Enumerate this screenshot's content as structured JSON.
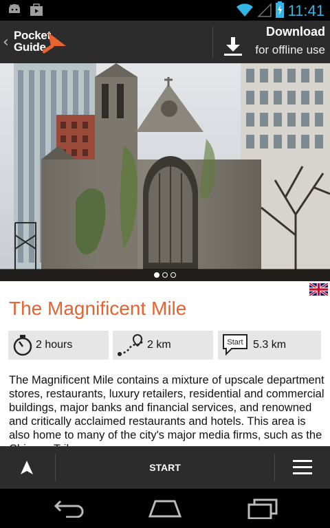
{
  "status_bar": {
    "time": "11:41",
    "icons": [
      "android-icon",
      "play-store-icon",
      "wifi-icon",
      "signal-icon",
      "battery-charging-icon"
    ],
    "accent_color": "#33b5e5"
  },
  "header": {
    "logo_line1": "Pocket",
    "logo_line2": "Guide",
    "download_title": "Download",
    "download_subtitle": "for offline use",
    "brand_color": "#e8622f"
  },
  "hero": {
    "pager_count": 3,
    "pager_active": 0
  },
  "tour": {
    "language_flag": "uk-flag-icon",
    "title": "The Magnificent Mile",
    "duration": "2 hours",
    "distance": "2 km",
    "start_badge": "Start",
    "distance_to_start": "5.3 km",
    "description": "The Magnificent Mile contains a mixture of upscale department stores, restaurants, luxury retailers, residential and commercial buildings, major banks and financial services, and renowned and critically acclaimed restaurants and hotels. This area is also home to many of the city's major media firms, such as the Chicago Tribune"
  },
  "action_bar": {
    "start_label": "START"
  }
}
